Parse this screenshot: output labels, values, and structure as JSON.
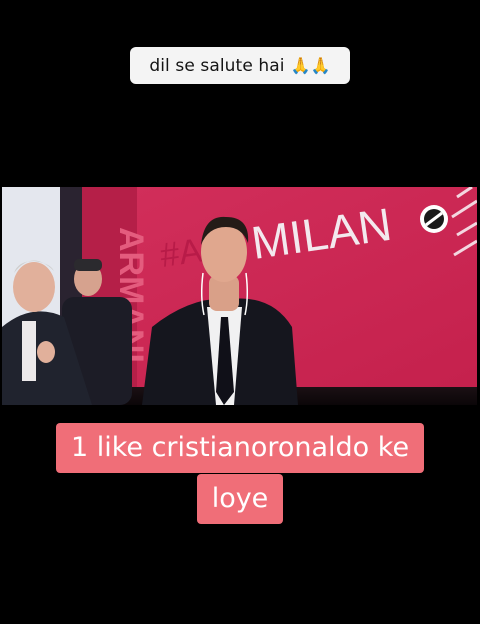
{
  "top_caption": {
    "text": "dil se salute hai",
    "emoji": "🙏🙏",
    "emoji_icon": "praying-hands-icon"
  },
  "video": {
    "wall_text": "MILAN",
    "hashtag_text": "#ALL",
    "side_text": "ARMANI",
    "logo_icon": "club-badge-icon",
    "colors": {
      "wall": "#cf2a55",
      "wall_dark": "#a81e46",
      "suit": "#15161e"
    }
  },
  "overlay_caption": {
    "line1": "1 like cristianoronaldo ke",
    "line2": "loye",
    "background": "#f06e78"
  }
}
